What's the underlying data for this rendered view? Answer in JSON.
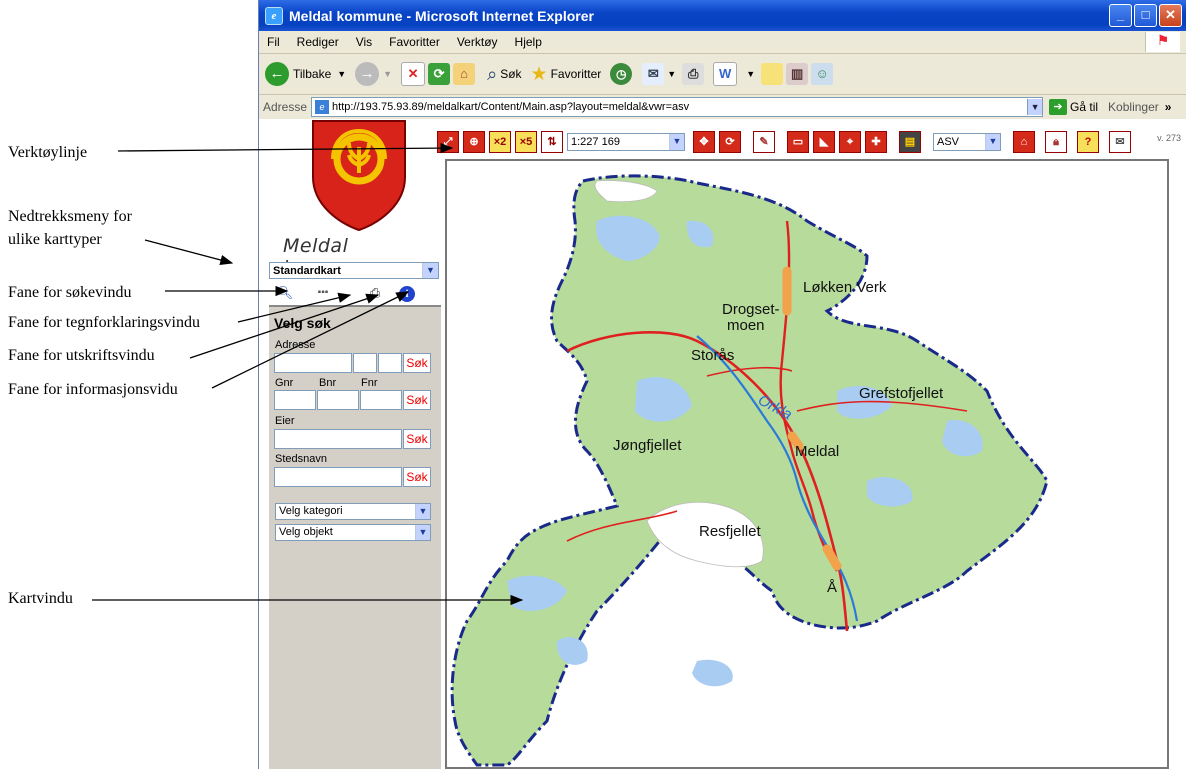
{
  "annotations": {
    "toolbar": "Verktøylinje",
    "maptype_dropdown_1": "Nedtrekksmeny for",
    "maptype_dropdown_2": "ulike karttyper",
    "search_tab": "Fane for søkevindu",
    "legend_tab": "Fane for tegnforklaringsvindu",
    "print_tab": "Fane for utskriftsvindu",
    "info_tab": "Fane for informasjonsvidu",
    "map_window": "Kartvindu"
  },
  "window": {
    "title": "Meldal kommune - Microsoft Internet Explorer",
    "buttons": [
      "minimize-icon",
      "maximize-icon",
      "close-icon"
    ]
  },
  "menu": [
    "Fil",
    "Rediger",
    "Vis",
    "Favoritter",
    "Verktøy",
    "Hjelp"
  ],
  "toolbar": {
    "back": "Tilbake",
    "search": "Søk",
    "favorites": "Favoritter"
  },
  "address": {
    "label": "Adresse",
    "url": "http://193.75.93.89/meldalkart/Content/Main.asp?layout=meldal&vwr=asv",
    "go": "Gå til",
    "links": "Koblinger"
  },
  "app": {
    "municipality": "Meldal kommune",
    "map_type": "Standardkart",
    "scale": "1:227 169",
    "layout": "ASV",
    "version": "v. 273",
    "colors": {
      "tool_red": "#d42a1a",
      "map_green": "#b7db9a",
      "water_blue": "#a9cdf2",
      "border_blue": "#1a2a8a"
    }
  },
  "search": {
    "title": "Velg søk",
    "address_label": "Adresse",
    "gnr": "Gnr",
    "bnr": "Bnr",
    "fnr": "Fnr",
    "owner_label": "Eier",
    "place_label": "Stedsnavn",
    "button": "Søk",
    "category": "Velg kategori",
    "object": "Velg objekt"
  },
  "map_labels": {
    "lokken": "Løkken Verk",
    "drogset1": "Drogset-",
    "drogset2": "moen",
    "storas": "Storås",
    "grefst": "Grefstofjellet",
    "orkla": "Orkla",
    "jong": "Jøngfjellet",
    "meldal": "Meldal",
    "resf": "Resfjellet",
    "a": "Å"
  }
}
